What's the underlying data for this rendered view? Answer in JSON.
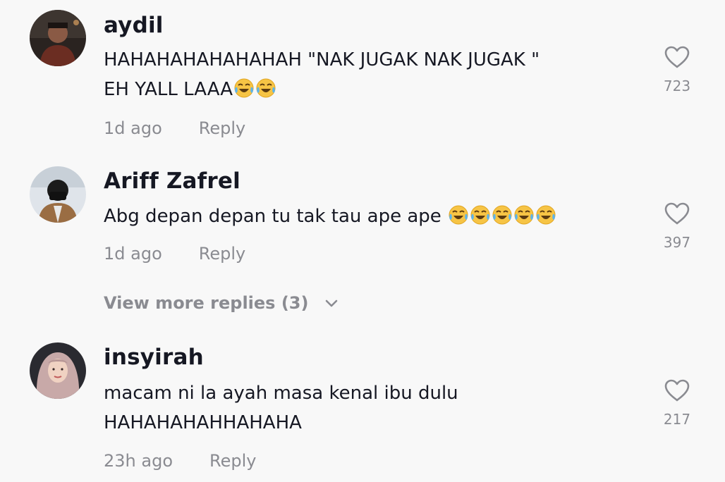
{
  "comments": [
    {
      "username": "aydil",
      "text_line1": "HAHAHAHAHAHAHAH \"NAK JUGAK NAK JUGAK \"",
      "text_line2": "EH YALL LAAA",
      "emoji": "face-with-tears-of-joy-icon",
      "time": "1d ago",
      "reply_label": "Reply",
      "likes": "723"
    },
    {
      "username": "Ariff Zafrel",
      "text_line1": "Abg depan depan tu tak tau ape ape ",
      "emoji": "face-with-tears-of-joy-icon",
      "time": "1d ago",
      "reply_label": "Reply",
      "likes": "397",
      "view_more": "View more replies (3)"
    },
    {
      "username": "insyirah",
      "text_line1": "macam ni la ayah masa kenal ibu dulu",
      "text_line2": "HAHAHAHAHHAHAHA",
      "time": "23h ago",
      "reply_label": "Reply",
      "likes": "217"
    }
  ],
  "colors": {
    "background": "#f8f8f8",
    "text": "#161823",
    "muted": "#8a8b91"
  }
}
